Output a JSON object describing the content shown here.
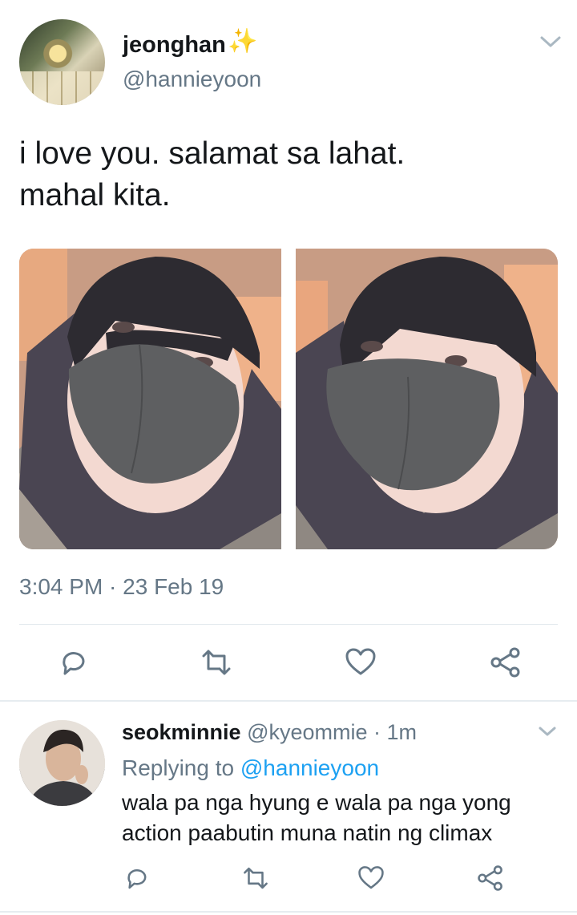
{
  "tweet": {
    "name": "jeonghan",
    "name_emoji": "✨",
    "handle": "@hannieyoon",
    "text_line1": "i love you. salamat sa lahat.",
    "text_line2": "mahal kita.",
    "timestamp": "3:04 PM · 23 Feb 19"
  },
  "reply": {
    "name": "seokminnie",
    "handle": "@kyeommie",
    "separator": " · ",
    "time": "1m",
    "replying_prefix": "Replying to ",
    "replying_handle": "@hannieyoon",
    "text_line1": "wala pa nga hyung e wala pa nga yong",
    "text_line2": "action paabutin muna natin ng climax"
  },
  "icons": {
    "reply": "reply-icon",
    "retweet": "retweet-icon",
    "like": "heart-icon",
    "share": "share-icon",
    "menu": "chevron-down-icon"
  },
  "colors": {
    "text": "#14171a",
    "muted": "#657786",
    "link": "#1da1f2",
    "divider": "#e1e8ed"
  }
}
